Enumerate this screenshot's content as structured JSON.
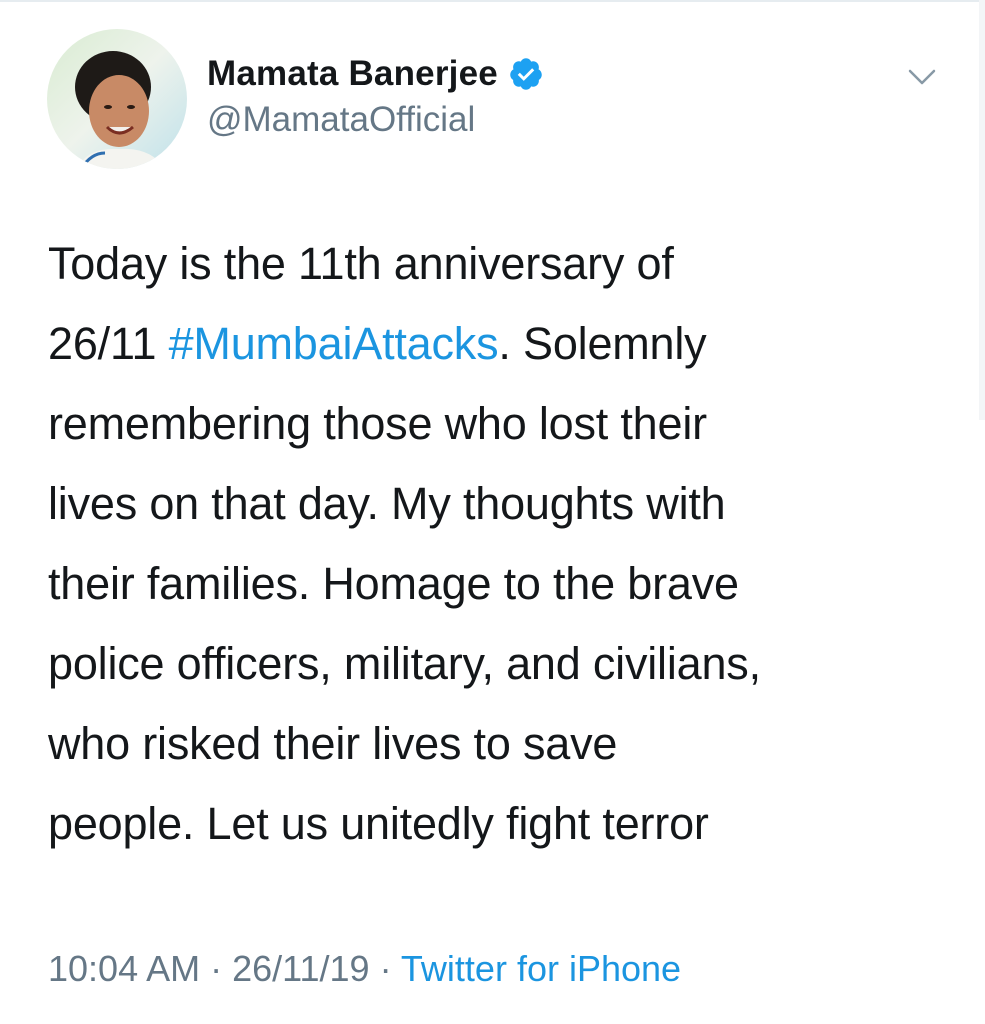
{
  "tweet": {
    "author": {
      "display_name": "Mamata Banerjee",
      "handle": "@MamataOfficial",
      "verified": true,
      "avatar": "profile-photo"
    },
    "text_before": "Today is the 11th anniversary of\n26/11 ",
    "hashtag": "#MumbaiAttacks",
    "text_after": ". Solemnly\nremembering those who lost their\nlives on that day. My thoughts with\ntheir families. Homage to the brave\npolice officers, military, and civilians,\nwho risked their lives to save\npeople. Let us unitedly fight terror",
    "time": "10:04 AM",
    "separator": " · ",
    "date": "26/11/19",
    "separator2": " · ",
    "source": "Twitter for iPhone"
  },
  "icons": {
    "verified": "verified-badge-icon",
    "menu": "chevron-down-icon"
  },
  "colors": {
    "link": "#1b95e0",
    "secondary_text": "#657786",
    "primary_text": "#14171a"
  }
}
